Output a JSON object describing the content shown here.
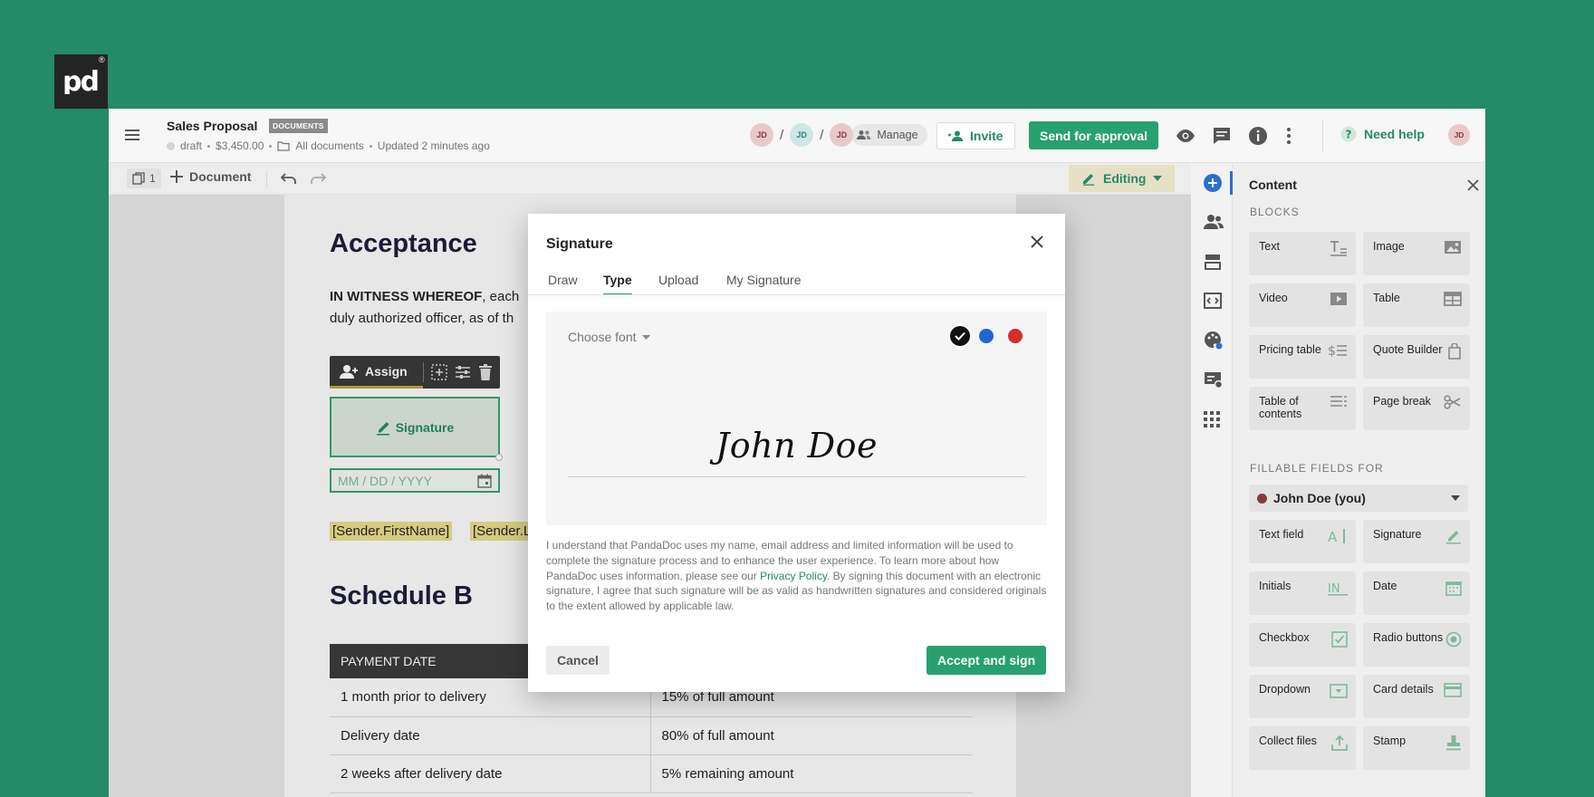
{
  "logo": {
    "text": "pd",
    "registered": "®"
  },
  "header": {
    "menu_icon": "hamburger-icon",
    "title": "Sales Proposal",
    "badge": "DOCUMENTS",
    "status": "draft",
    "amount": "$3,450.00",
    "folder": "All documents",
    "updated": "Updated 2 minutes ago",
    "assignees": [
      {
        "initials": "JD",
        "color": "#e9c9c9"
      },
      {
        "initials": "JD",
        "color": "#cfe6e6"
      },
      {
        "initials": "JD",
        "color": "#e9c9c9"
      }
    ],
    "separator": "/",
    "manage_label": "Manage",
    "invite_label": "Invite",
    "send_label": "Send for approval",
    "help_label": "Need help",
    "user_initials": "JD"
  },
  "toolbar": {
    "page_count": "1",
    "add_document_label": "Document",
    "mode_label": "Editing"
  },
  "document": {
    "heading_acceptance": "Acceptance",
    "witness_bold": "IN WITNESS WHEREOF",
    "witness_text": ", each",
    "witness_line2": "duly authorized officer, as of th",
    "assign_label": "Assign",
    "signature_field_label": "Signature",
    "date_placeholder": "MM / DD / YYYY",
    "var_first_name": "[Sender.FirstName]",
    "var_last_name": "[Sender.LastName]",
    "heading_schedule": "Schedule B",
    "table": {
      "header": "PAYMENT DATE",
      "rows": [
        [
          "1 month prior to delivery",
          "15% of full amount"
        ],
        [
          "Delivery date",
          "80% of full amount"
        ],
        [
          "2 weeks after delivery date",
          "5% remaining amount"
        ]
      ]
    }
  },
  "sidebar_rail": [
    "add-content-icon",
    "recipients-icon",
    "variables-icon",
    "embed-icon",
    "design-icon",
    "payments-icon",
    "apps-icon"
  ],
  "content_panel": {
    "title": "Content",
    "blocks_label": "BLOCKS",
    "blocks": [
      {
        "label": "Text",
        "icon": "text-icon"
      },
      {
        "label": "Image",
        "icon": "image-icon"
      },
      {
        "label": "Video",
        "icon": "video-icon"
      },
      {
        "label": "Table",
        "icon": "table-icon"
      },
      {
        "label": "Pricing table",
        "icon": "pricing-table-icon"
      },
      {
        "label": "Quote Builder",
        "icon": "quote-builder-icon"
      },
      {
        "label": "Table of contents",
        "icon": "toc-icon"
      },
      {
        "label": "Page break",
        "icon": "scissors-icon"
      }
    ],
    "fillable_label": "FILLABLE FIELDS FOR",
    "recipient": "John Doe (you)",
    "recipient_color": "#8a3a3a",
    "fields": [
      {
        "label": "Text field",
        "icon": "text-field-icon"
      },
      {
        "label": "Signature",
        "icon": "signature-pen-icon"
      },
      {
        "label": "Initials",
        "icon": "initials-icon"
      },
      {
        "label": "Date",
        "icon": "calendar-icon"
      },
      {
        "label": "Checkbox",
        "icon": "checkbox-icon"
      },
      {
        "label": "Radio buttons",
        "icon": "radio-icon"
      },
      {
        "label": "Dropdown",
        "icon": "dropdown-icon"
      },
      {
        "label": "Card details",
        "icon": "card-icon"
      },
      {
        "label": "Collect files",
        "icon": "upload-icon"
      },
      {
        "label": "Stamp",
        "icon": "stamp-icon"
      }
    ]
  },
  "modal": {
    "title": "Signature",
    "tabs": [
      "Draw",
      "Type",
      "Upload",
      "My Signature"
    ],
    "active_tab": "Type",
    "choose_font": "Choose font",
    "colors": [
      "#111111",
      "#1f66d1",
      "#d62d2d"
    ],
    "selected_color": "#111111",
    "signature_text": "John Doe",
    "disclaimer_1": "I understand that PandaDoc uses my name, email address and limited information will be used to complete the signature process and to enhance the user experience. To learn more about how PandaDoc uses information, please see our ",
    "privacy_link": "Privacy Policy",
    "disclaimer_2": ". By signing this document with an electronic signature, I agree that such signature will be as valid as handwritten signatures and considered originals to the extent allowed by applicable law.",
    "cancel_label": "Cancel",
    "accept_label": "Accept and sign"
  },
  "colors": {
    "background": "#248a68",
    "accent": "#28a06f",
    "primary_blue": "#2c6fd0"
  }
}
